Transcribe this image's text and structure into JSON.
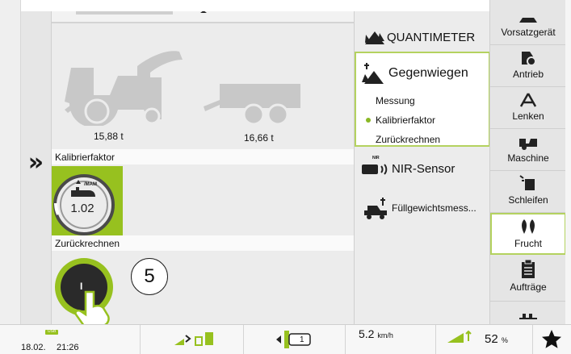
{
  "weights": {
    "harvester": "15,88 t",
    "trailer": "16,66 t"
  },
  "calibration": {
    "header": "Kalibrierfaktor",
    "value": "1.02",
    "gauge_unit": "/MAM"
  },
  "recalc": {
    "header": "Zurückrechnen",
    "button_label": "I"
  },
  "step_marker": "5",
  "menu": {
    "quantimeter": "QUANTIMETER",
    "counterweigh": "Gegenwiegen",
    "sub_items": [
      "Messung",
      "Kalibrierfaktor",
      "Zurückrechnen"
    ],
    "selected_sub": "Kalibrierfaktor",
    "nir_badge": "NIR",
    "nir": "NIR-Sensor",
    "fill_weight": "Füllgewichtsmess..."
  },
  "nav": {
    "items": [
      "Vorsatzgerät",
      "Antrieb",
      "Lenken",
      "Maschine",
      "Schleifen",
      "Frucht",
      "Aufträge"
    ],
    "active": "Frucht"
  },
  "status": {
    "usb": "USB",
    "date": "18.02.",
    "time": "21:26",
    "gear": "1",
    "speed": "5.2",
    "speed_unit": "km/h",
    "percent": "52",
    "percent_unit": "%"
  },
  "colors": {
    "accent": "#97c11f",
    "panel": "#ececec",
    "nav": "#e5e5e5"
  }
}
